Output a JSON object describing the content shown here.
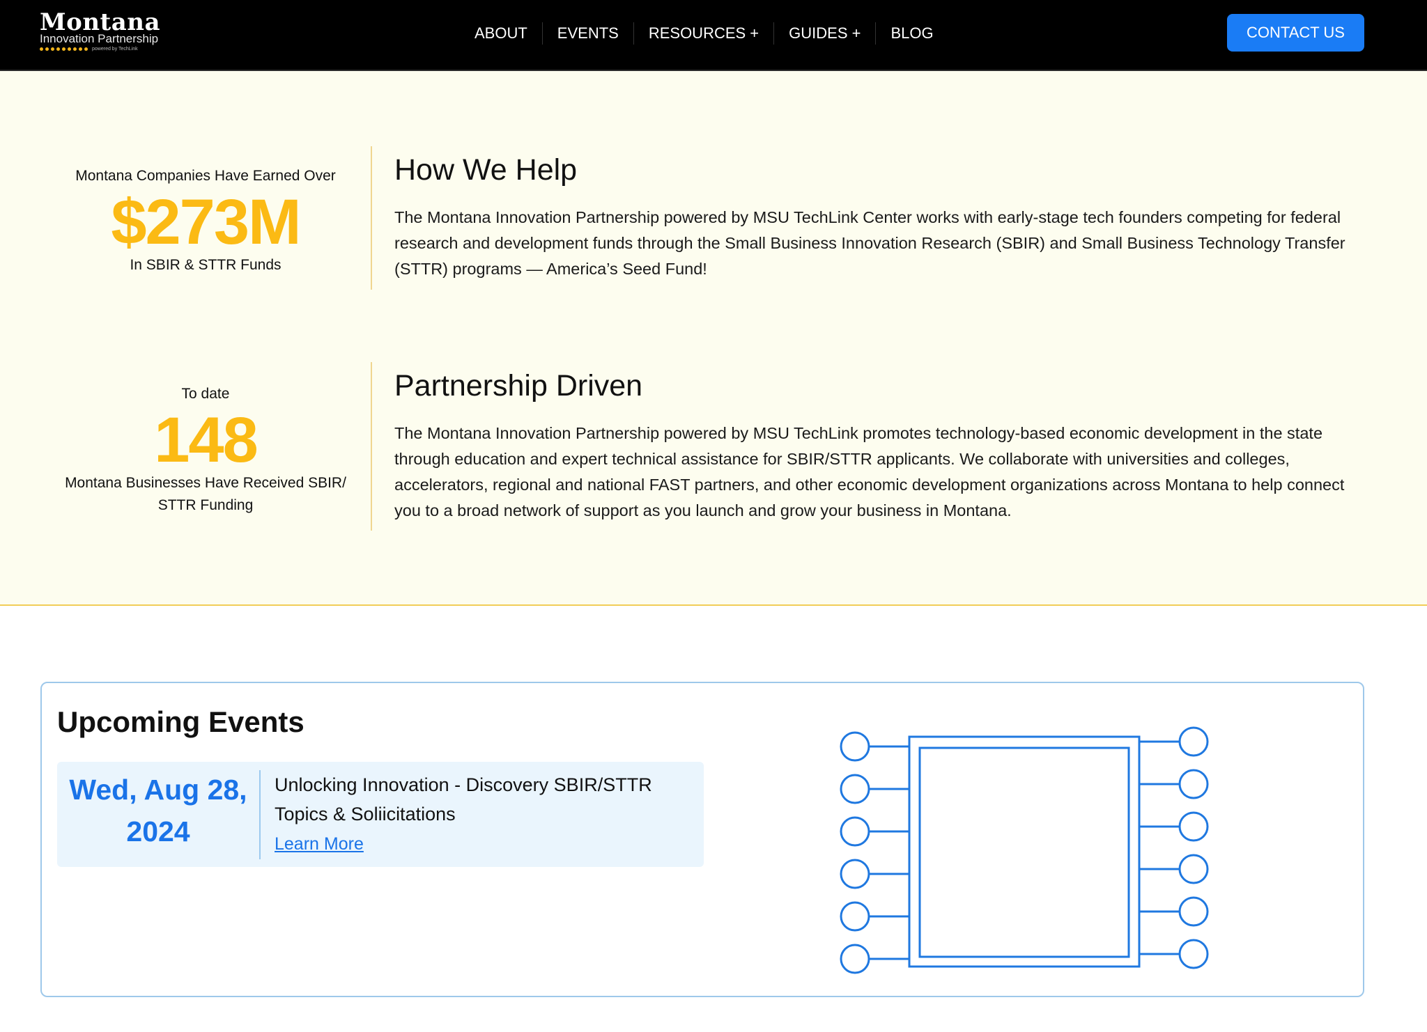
{
  "header": {
    "logo": {
      "title": "Montana",
      "subtitle": "Innovation Partnership",
      "tagline": "powered by TechLink",
      "dot_color": "#f2b51c"
    },
    "nav": [
      {
        "label": "ABOUT"
      },
      {
        "label": "EVENTS"
      },
      {
        "label": "RESOURCES +"
      },
      {
        "label": "GUIDES +"
      },
      {
        "label": "BLOG"
      }
    ],
    "contact_label": "CONTACT US",
    "accent_color": "#1a7cf5"
  },
  "stats": [
    {
      "pre": "Montana Companies Have Earned Over",
      "value": "$273M",
      "post": "In SBIR & STTR Funds"
    },
    {
      "pre": "To date",
      "value": "148",
      "post": "Montana Businesses Have Received SBIR/ STTR Funding"
    }
  ],
  "sections": [
    {
      "heading": "How We Help",
      "body": "The Montana Innovation Partnership powered by MSU TechLink Center works with early-stage tech founders competing for federal research and development funds through the Small Business Innovation Research (SBIR) and Small Business Technology Transfer (STTR) programs — America’s Seed Fund!"
    },
    {
      "heading": "Partnership Driven",
      "body": "The Montana Innovation Partnership powered by MSU TechLink promotes technology-based economic development in the state through education and expert technical assistance for SBIR/STTR applicants. We collaborate with universities and colleges, accelerators, regional and national FAST partners, and other economic development organizations across Montana to help connect you to a broad network of support as you launch and grow your business in Montana."
    }
  ],
  "events": {
    "title": "Upcoming Events",
    "items": [
      {
        "date": "Wed, Aug 28, 2024",
        "title": "Unlocking Innovation - Discovery SBIR/STTR Topics & Soliicitations",
        "link_label": "Learn More"
      }
    ],
    "illustration": "microchip-icon"
  },
  "colors": {
    "stat_highlight": "#fbba14",
    "cream_bg": "#fdfdef",
    "link_blue": "#1a73e8"
  }
}
